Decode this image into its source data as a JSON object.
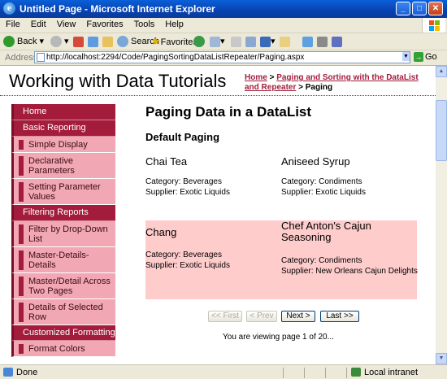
{
  "window": {
    "title": "Untitled Page - Microsoft Internet Explorer",
    "buttons": {
      "minimize": "_",
      "maximize": "□",
      "close": "✕"
    }
  },
  "menu": [
    "File",
    "Edit",
    "View",
    "Favorites",
    "Tools",
    "Help"
  ],
  "toolbar": {
    "back": "Back",
    "search": "Search",
    "favorites": "Favorites"
  },
  "address": {
    "label": "Address",
    "url": "http://localhost:2294/Code/PagingSortingDataListRepeater/Paging.aspx",
    "go": "Go"
  },
  "site": {
    "title": "Working with Data Tutorials",
    "breadcrumb": {
      "home": "Home",
      "sep1": ">",
      "section": "Paging and Sorting with the DataList and Repeater",
      "sep2": ">",
      "current": "Paging"
    }
  },
  "sidebar": [
    {
      "type": "head",
      "label": "Home"
    },
    {
      "type": "head",
      "label": "Basic Reporting"
    },
    {
      "type": "sub",
      "label": "Simple Display"
    },
    {
      "type": "sub",
      "label": "Declarative Parameters"
    },
    {
      "type": "sub",
      "label": "Setting Parameter Values"
    },
    {
      "type": "head",
      "label": "Filtering Reports"
    },
    {
      "type": "sub",
      "label": "Filter by Drop-Down List"
    },
    {
      "type": "sub",
      "label": "Master-Details-Details"
    },
    {
      "type": "sub",
      "label": "Master/Detail Across Two Pages"
    },
    {
      "type": "sub",
      "label": "Details of Selected Row"
    },
    {
      "type": "head",
      "label": "Customized Formatting"
    },
    {
      "type": "sub",
      "label": "Format Colors"
    }
  ],
  "main": {
    "heading": "Paging Data in a DataList",
    "subheading": "Default Paging",
    "products": [
      {
        "name": "Chai Tea",
        "category": "Category: Beverages",
        "supplier": "Supplier: Exotic Liquids"
      },
      {
        "name": "Aniseed Syrup",
        "category": "Category: Condiments",
        "supplier": "Supplier: Exotic Liquids"
      },
      {
        "name": "Chang",
        "category": "Category: Beverages",
        "supplier": "Supplier: Exotic Liquids"
      },
      {
        "name": "Chef Anton's Cajun Seasoning",
        "category": "Category: Condiments",
        "supplier": "Supplier: New Orleans Cajun Delights"
      }
    ],
    "pager": {
      "first": "<< First",
      "prev": "< Prev",
      "next": "Next >",
      "last": "Last >>"
    },
    "status": "You are viewing page 1 of 20..."
  },
  "statusbar": {
    "left": "Done",
    "zone": "Local intranet"
  },
  "colors": {
    "accent": "#a31c3c",
    "sidebarSub": "#f2a8b4",
    "altRow": "#ffcccc"
  }
}
